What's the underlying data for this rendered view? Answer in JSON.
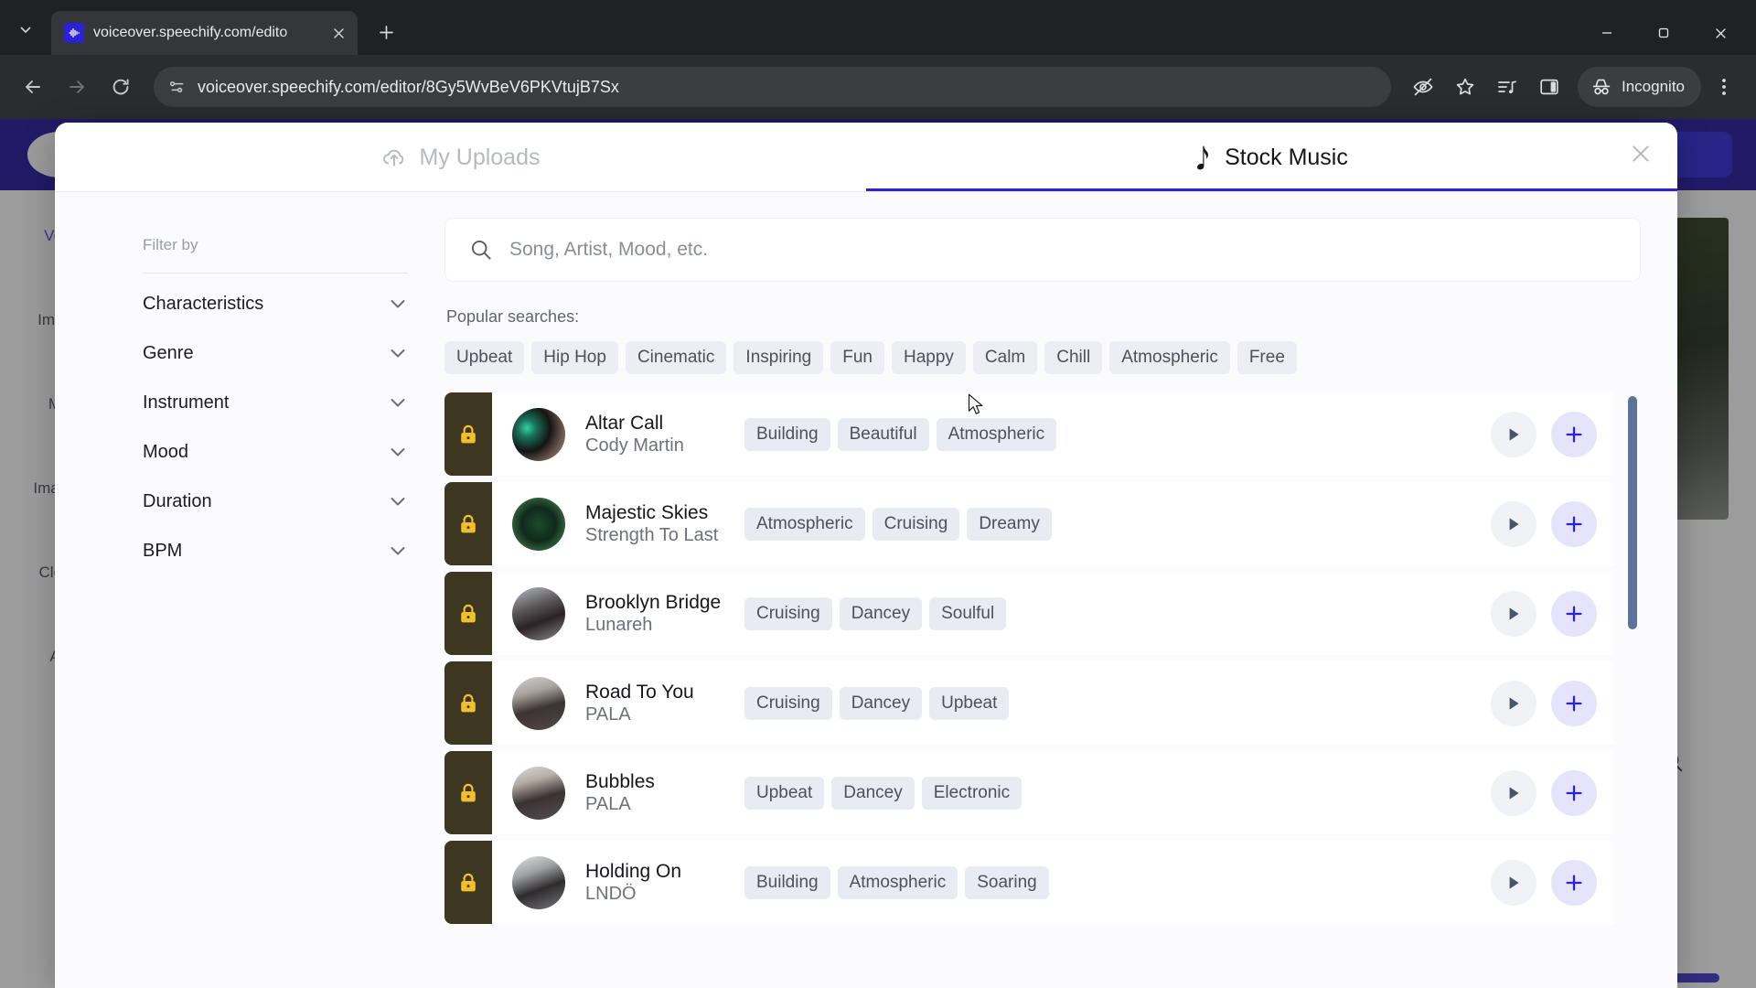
{
  "browser": {
    "tab": {
      "title": "voiceover.speechify.com/edito",
      "favicon": "speechify-waveform-icon"
    },
    "new_tab_label": "+",
    "url": "voiceover.speechify.com/editor/8Gy5WvBeV6PKVtujB7Sx",
    "profile_label": "Incognito",
    "toolbar_icons": [
      "eye-off-icon",
      "bookmark-star-icon",
      "media-playlist-icon",
      "side-panel-icon",
      "incognito-icon",
      "browser-menu-icon"
    ],
    "nav_icons": [
      "back-icon",
      "forward-icon",
      "reload-icon",
      "site-settings-icon"
    ],
    "window_controls": [
      "minimize-icon",
      "maximize-icon",
      "close-icon"
    ]
  },
  "background_page": {
    "sidebar_items": [
      {
        "label": "Voi",
        "active": true
      },
      {
        "label": "Impo",
        "active": false
      },
      {
        "label": "M",
        "active": false
      },
      {
        "label": "Image",
        "active": false
      },
      {
        "label": "Clon",
        "active": false
      },
      {
        "label": "A",
        "active": false
      }
    ]
  },
  "modal": {
    "tabs": [
      {
        "label": "My Uploads",
        "icon": "upload-cloud-icon",
        "active": false
      },
      {
        "label": "Stock Music",
        "icon": "music-note-icon",
        "active": true
      }
    ],
    "close_label": "×",
    "filters": {
      "label": "Filter by",
      "groups": [
        {
          "label": "Characteristics"
        },
        {
          "label": "Genre"
        },
        {
          "label": "Instrument"
        },
        {
          "label": "Mood"
        },
        {
          "label": "Duration"
        },
        {
          "label": "BPM"
        }
      ]
    },
    "search": {
      "placeholder": "Song, Artist, Mood, etc.",
      "value": "",
      "icon": "search-icon"
    },
    "popular": {
      "label": "Popular searches:",
      "chips": [
        "Upbeat",
        "Hip Hop",
        "Cinematic",
        "Inspiring",
        "Fun",
        "Happy",
        "Calm",
        "Chill",
        "Atmospheric",
        "Free"
      ]
    },
    "tracks": [
      {
        "title": "Altar Call",
        "artist": "Cody Martin",
        "tags": [
          "Building",
          "Beautiful",
          "Atmospheric"
        ],
        "locked": true
      },
      {
        "title": "Majestic Skies",
        "artist": "Strength To Last",
        "tags": [
          "Atmospheric",
          "Cruising",
          "Dreamy"
        ],
        "locked": true
      },
      {
        "title": "Brooklyn Bridge",
        "artist": "Lunareh",
        "tags": [
          "Cruising",
          "Dancey",
          "Soulful"
        ],
        "locked": true
      },
      {
        "title": "Road To You",
        "artist": "PALA",
        "tags": [
          "Cruising",
          "Dancey",
          "Upbeat"
        ],
        "locked": true
      },
      {
        "title": "Bubbles",
        "artist": "PALA",
        "tags": [
          "Upbeat",
          "Dancey",
          "Electronic"
        ],
        "locked": true
      },
      {
        "title": "Holding On",
        "artist": "LNDÖ",
        "tags": [
          "Building",
          "Atmospheric",
          "Soaring"
        ],
        "locked": true
      }
    ],
    "row_icons": {
      "lock": "lock-icon",
      "play": "play-icon",
      "add": "plus-icon"
    }
  },
  "colors": {
    "accent": "#2b22d6",
    "chip_bg": "#e9ebf2",
    "lock_badge_bg": "#3d3721",
    "lock_glyph": "#f0bf2b",
    "scrollbar": "#5a7396",
    "browser_chrome": "#202124"
  }
}
